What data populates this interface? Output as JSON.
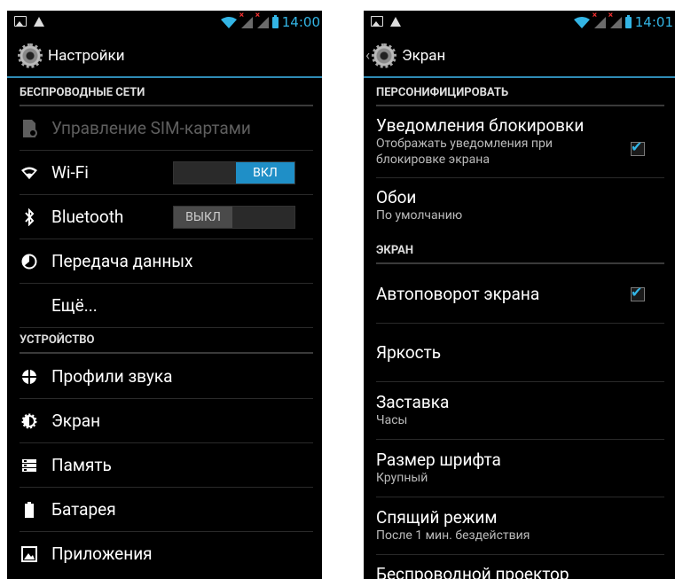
{
  "left": {
    "status_time": "14:00",
    "title": "Настройки",
    "sections": {
      "wireless": "БЕСПРОВОДНЫЕ СЕТИ",
      "device": "УСТРОЙСТВО"
    },
    "items": {
      "sim": "Управление SIM-картами",
      "wifi": "Wi-Fi",
      "wifi_toggle": "ВКЛ",
      "bluetooth": "Bluetooth",
      "bluetooth_toggle": "ВЫКЛ",
      "data": "Передача данных",
      "more": "Ещё...",
      "sound": "Профили звука",
      "display": "Экран",
      "storage": "Память",
      "battery": "Батарея",
      "apps": "Приложения"
    }
  },
  "right": {
    "status_time": "14:01",
    "title": "Экран",
    "sections": {
      "personalize": "ПЕРСОНИФИЦИРОВАТЬ",
      "screen": "ЭКРАН"
    },
    "items": {
      "lock_notif_title": "Уведомления блокировки",
      "lock_notif_sub": "Отображать уведомления при блокировке экрана",
      "lock_notif_checked": true,
      "wallpaper_title": "Обои",
      "wallpaper_sub": "По умолчанию",
      "autorotate_title": "Автоповорот экрана",
      "autorotate_checked": true,
      "brightness_title": "Яркость",
      "daydream_title": "Заставка",
      "daydream_sub": "Часы",
      "fontsize_title": "Размер шрифта",
      "fontsize_sub": "Крупный",
      "sleep_title": "Спящий режим",
      "sleep_sub": "После 1 мин. бездействия",
      "cast_title": "Беспроводной проектор"
    }
  },
  "colors": {
    "accent": "#33b5e5",
    "toggle_on": "#1f8fc7",
    "background": "#000000"
  }
}
